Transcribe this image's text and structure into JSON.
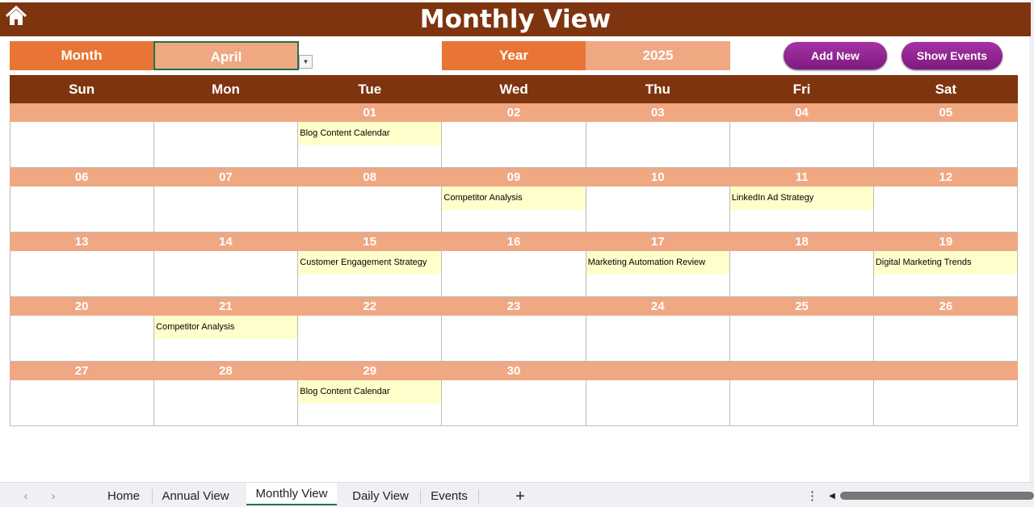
{
  "title": "Monthly View",
  "icons": {
    "home": "home-icon"
  },
  "colors": {
    "title_bg": "#7e340f",
    "label_bg": "#e87535",
    "value_bg": "#f0a883",
    "button": "#8e218e",
    "event_bg": "#ffffcc"
  },
  "controls": {
    "month_label": "Month",
    "month_value": "April",
    "year_label": "Year",
    "year_value": "2025",
    "add_new": "Add New",
    "show_events": "Show Events"
  },
  "weekdays": [
    "Sun",
    "Mon",
    "Tue",
    "Wed",
    "Thu",
    "Fri",
    "Sat"
  ],
  "weeks": [
    {
      "days": [
        "",
        "",
        "01",
        "02",
        "03",
        "04",
        "05"
      ],
      "events": [
        "",
        "",
        "Blog Content Calendar",
        "",
        "",
        "",
        ""
      ]
    },
    {
      "days": [
        "06",
        "07",
        "08",
        "09",
        "10",
        "11",
        "12"
      ],
      "events": [
        "",
        "",
        "",
        "Competitor Analysis",
        "",
        "LinkedIn Ad Strategy",
        ""
      ]
    },
    {
      "days": [
        "13",
        "14",
        "15",
        "16",
        "17",
        "18",
        "19"
      ],
      "events": [
        "",
        "",
        "Customer Engagement Strategy",
        "",
        "Marketing Automation Review",
        "",
        "Digital Marketing Trends"
      ]
    },
    {
      "days": [
        "20",
        "21",
        "22",
        "23",
        "24",
        "25",
        "26"
      ],
      "events": [
        "",
        "Competitor Analysis",
        "",
        "",
        "",
        "",
        ""
      ]
    },
    {
      "days": [
        "27",
        "28",
        "29",
        "30",
        "",
        "",
        ""
      ],
      "events": [
        "",
        "",
        "Blog Content Calendar",
        "",
        "",
        "",
        ""
      ]
    }
  ],
  "sheet_tabs": [
    {
      "label": "Home"
    },
    {
      "label": "Annual View"
    },
    {
      "label": "Monthly View",
      "active": true
    },
    {
      "label": "Daily View"
    },
    {
      "label": "Events"
    }
  ],
  "add_sheet": "+"
}
